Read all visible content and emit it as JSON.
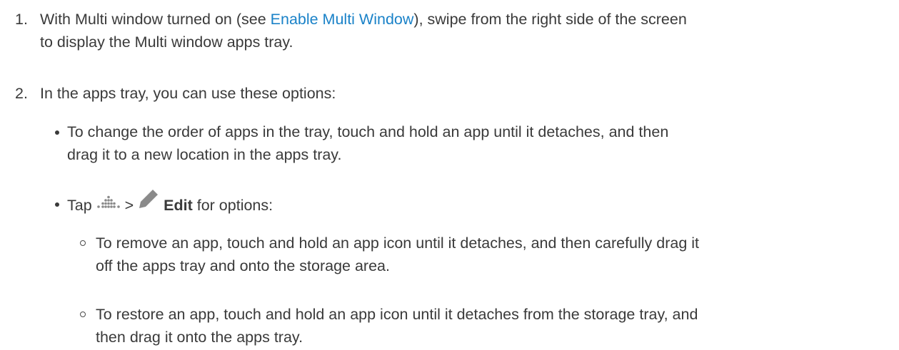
{
  "steps": [
    {
      "number": "1.",
      "text_before_link": "With Multi window turned on (see ",
      "link_text": "Enable Multi Window",
      "text_after_link": "), swipe from the right side of the screen",
      "line2": "to display the Multi window apps tray."
    },
    {
      "number": "2.",
      "text": "In the apps tray, you can use these options:"
    }
  ],
  "bullets": [
    {
      "line1": "To change the order of apps in the tray, touch and hold an app until it detaches, and then",
      "line2": "drag it to a new location in the apps tray."
    },
    {
      "tap_label": "Tap ",
      "separator": " > ",
      "edit_label": "Edit",
      "suffix": " for options:",
      "icons": [
        "more-dots-icon",
        "pencil-icon"
      ]
    }
  ],
  "sub_bullets": [
    {
      "line1": "To remove an app, touch and hold an app icon until it detaches, and then carefully drag it",
      "line2": "off the apps tray and onto the storage area."
    },
    {
      "line1": "To restore an app, touch and hold an app icon until it detaches from the storage tray, and",
      "line2": "then drag it onto the apps tray."
    }
  ],
  "colors": {
    "text": "#3a3a3a",
    "link": "#1a82c8",
    "icon": "#8a8a8a"
  }
}
